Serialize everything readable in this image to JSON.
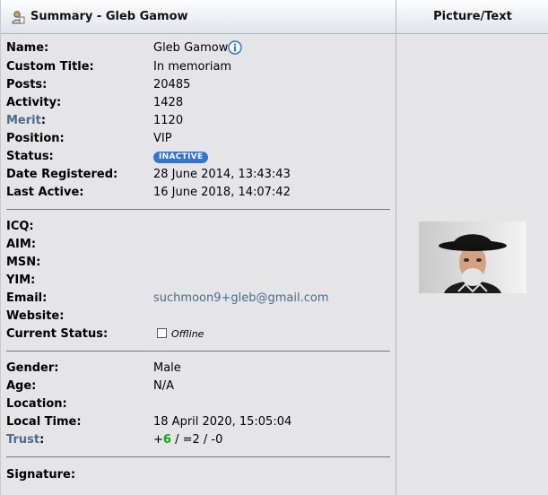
{
  "header": {
    "title": "Summary - Gleb Gamow",
    "right_title": "Picture/Text"
  },
  "fields": {
    "name": {
      "label": "Name:",
      "value": "Gleb Gamow"
    },
    "custom_title": {
      "label": "Custom Title:",
      "value": "In memoriam"
    },
    "posts": {
      "label": "Posts:",
      "value": "20485"
    },
    "activity": {
      "label": "Activity:",
      "value": "1428"
    },
    "merit": {
      "label": "Merit",
      "suffix": ":",
      "value": "1120"
    },
    "position": {
      "label": "Position:",
      "value": "VIP"
    },
    "status": {
      "label": "Status:",
      "value": "INACTIVE"
    },
    "date_registered": {
      "label": "Date Registered:",
      "value": "28 June 2014, 13:43:43"
    },
    "last_active": {
      "label": "Last Active:",
      "value": "16 June 2018, 14:07:42"
    },
    "icq": {
      "label": "ICQ:"
    },
    "aim": {
      "label": "AIM:"
    },
    "msn": {
      "label": "MSN:"
    },
    "yim": {
      "label": "YIM:"
    },
    "email": {
      "label": "Email:",
      "value": "suchmoon9+gleb@gmail.com"
    },
    "website": {
      "label": "Website:"
    },
    "current_status": {
      "label": "Current Status:",
      "value": "Offline"
    },
    "gender": {
      "label": "Gender:",
      "value": "Male"
    },
    "age": {
      "label": "Age:",
      "value": "N/A"
    },
    "location": {
      "label": "Location:"
    },
    "local_time": {
      "label": "Local Time:",
      "value": "18 April 2020, 15:05:04"
    },
    "trust": {
      "label": "Trust",
      "suffix": ":",
      "plus": "+",
      "positive": "6",
      "rest": " / =2 / -0"
    },
    "signature": {
      "label": "Signature:"
    }
  },
  "icons": {
    "header": "user-icon",
    "name": "info-icon",
    "status": "checkbox-icon",
    "picture": "avatar-photo"
  },
  "colors": {
    "link": "#4a6b8c",
    "badge": "#3573d0",
    "trust_positive": "#14a614",
    "background": "#e5e5e8"
  }
}
